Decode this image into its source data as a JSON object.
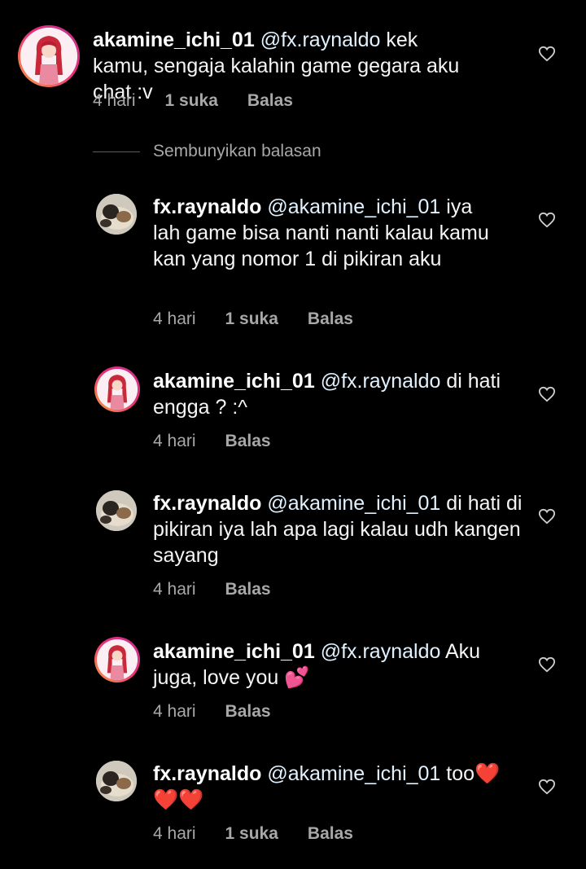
{
  "hide_replies_label": "Sembunyikan balasan",
  "colors": {
    "background": "#000000",
    "text": "#f5f5f5",
    "meta": "#a8a8a8",
    "mention": "#e0f1ff",
    "story_ring": "#ee2a7b"
  },
  "comments": [
    {
      "user": "akamine_ichi_01",
      "mention": "@fx.raynaldo",
      "text": " kek kamu, sengaja kalahin game gegara aku chat :v",
      "time": "4 hari",
      "likes": "1 suka",
      "reply": "Balas"
    },
    {
      "user": "fx.raynaldo",
      "mention": "@akamine_ichi_01",
      "text": " iya lah game bisa nanti nanti kalau kamu kan yang nomor 1 di pikiran aku",
      "time": "4 hari",
      "likes": "1 suka",
      "reply": "Balas"
    },
    {
      "user": "akamine_ichi_01",
      "mention": "@fx.raynaldo",
      "text": " di hati engga ? :^",
      "time": "4 hari",
      "reply": "Balas"
    },
    {
      "user": "fx.raynaldo",
      "mention": "@akamine_ichi_01",
      "text": " di hati di pikiran iya lah apa lagi kalau udh kangen sayang",
      "time": "4 hari",
      "reply": "Balas"
    },
    {
      "user": "akamine_ichi_01",
      "mention": "@fx.raynaldo",
      "text": " Aku juga, love you",
      "emoji": "💕",
      "time": "4 hari",
      "reply": "Balas"
    },
    {
      "user": "fx.raynaldo",
      "mention": "@akamine_ichi_01",
      "text": " too",
      "emoji": "❤️❤️❤️",
      "time": "4 hari",
      "likes": "1 suka",
      "reply": "Balas"
    }
  ]
}
